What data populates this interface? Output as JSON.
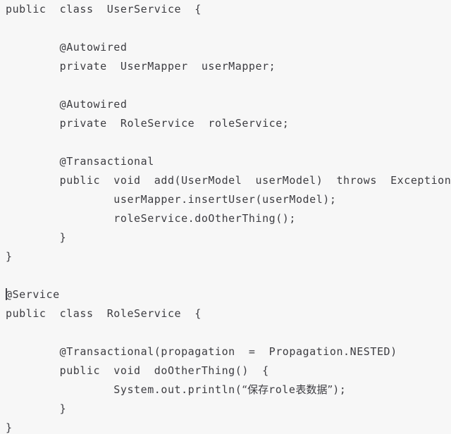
{
  "editor": {
    "background_color": "#f7f7f7",
    "text_color": "#3c3c41",
    "caret_color": "#4b4b52",
    "language": "java",
    "caret_line_index": 15,
    "lines": [
      {
        "id": "line-1",
        "text": "public  class  UserService  {"
      },
      {
        "id": "line-2",
        "text": ""
      },
      {
        "id": "line-3",
        "text": "        @Autowired"
      },
      {
        "id": "line-4",
        "text": "        private  UserMapper  userMapper;"
      },
      {
        "id": "line-5",
        "text": ""
      },
      {
        "id": "line-6",
        "text": "        @Autowired"
      },
      {
        "id": "line-7",
        "text": "        private  RoleService  roleService;"
      },
      {
        "id": "line-8",
        "text": ""
      },
      {
        "id": "line-9",
        "text": "        @Transactional"
      },
      {
        "id": "line-10",
        "text": "        public  void  add(UserModel  userModel)  throws  Exception  {"
      },
      {
        "id": "line-11",
        "text": "                userMapper.insertUser(userModel);"
      },
      {
        "id": "line-12",
        "text": "                roleService.doOtherThing();"
      },
      {
        "id": "line-13",
        "text": "        }"
      },
      {
        "id": "line-14",
        "text": "}"
      },
      {
        "id": "line-15",
        "text": ""
      },
      {
        "id": "line-16",
        "text": "@Service"
      },
      {
        "id": "line-17",
        "text": "public  class  RoleService  {"
      },
      {
        "id": "line-18",
        "text": ""
      },
      {
        "id": "line-19",
        "text": "        @Transactional(propagation  =  Propagation.NESTED)"
      },
      {
        "id": "line-20",
        "text": "        public  void  doOtherThing()  {"
      },
      {
        "id": "line-21",
        "text": "                System.out.println(“保存role表数据”);"
      },
      {
        "id": "line-22",
        "text": "        }"
      },
      {
        "id": "line-23",
        "text": "}"
      }
    ]
  }
}
